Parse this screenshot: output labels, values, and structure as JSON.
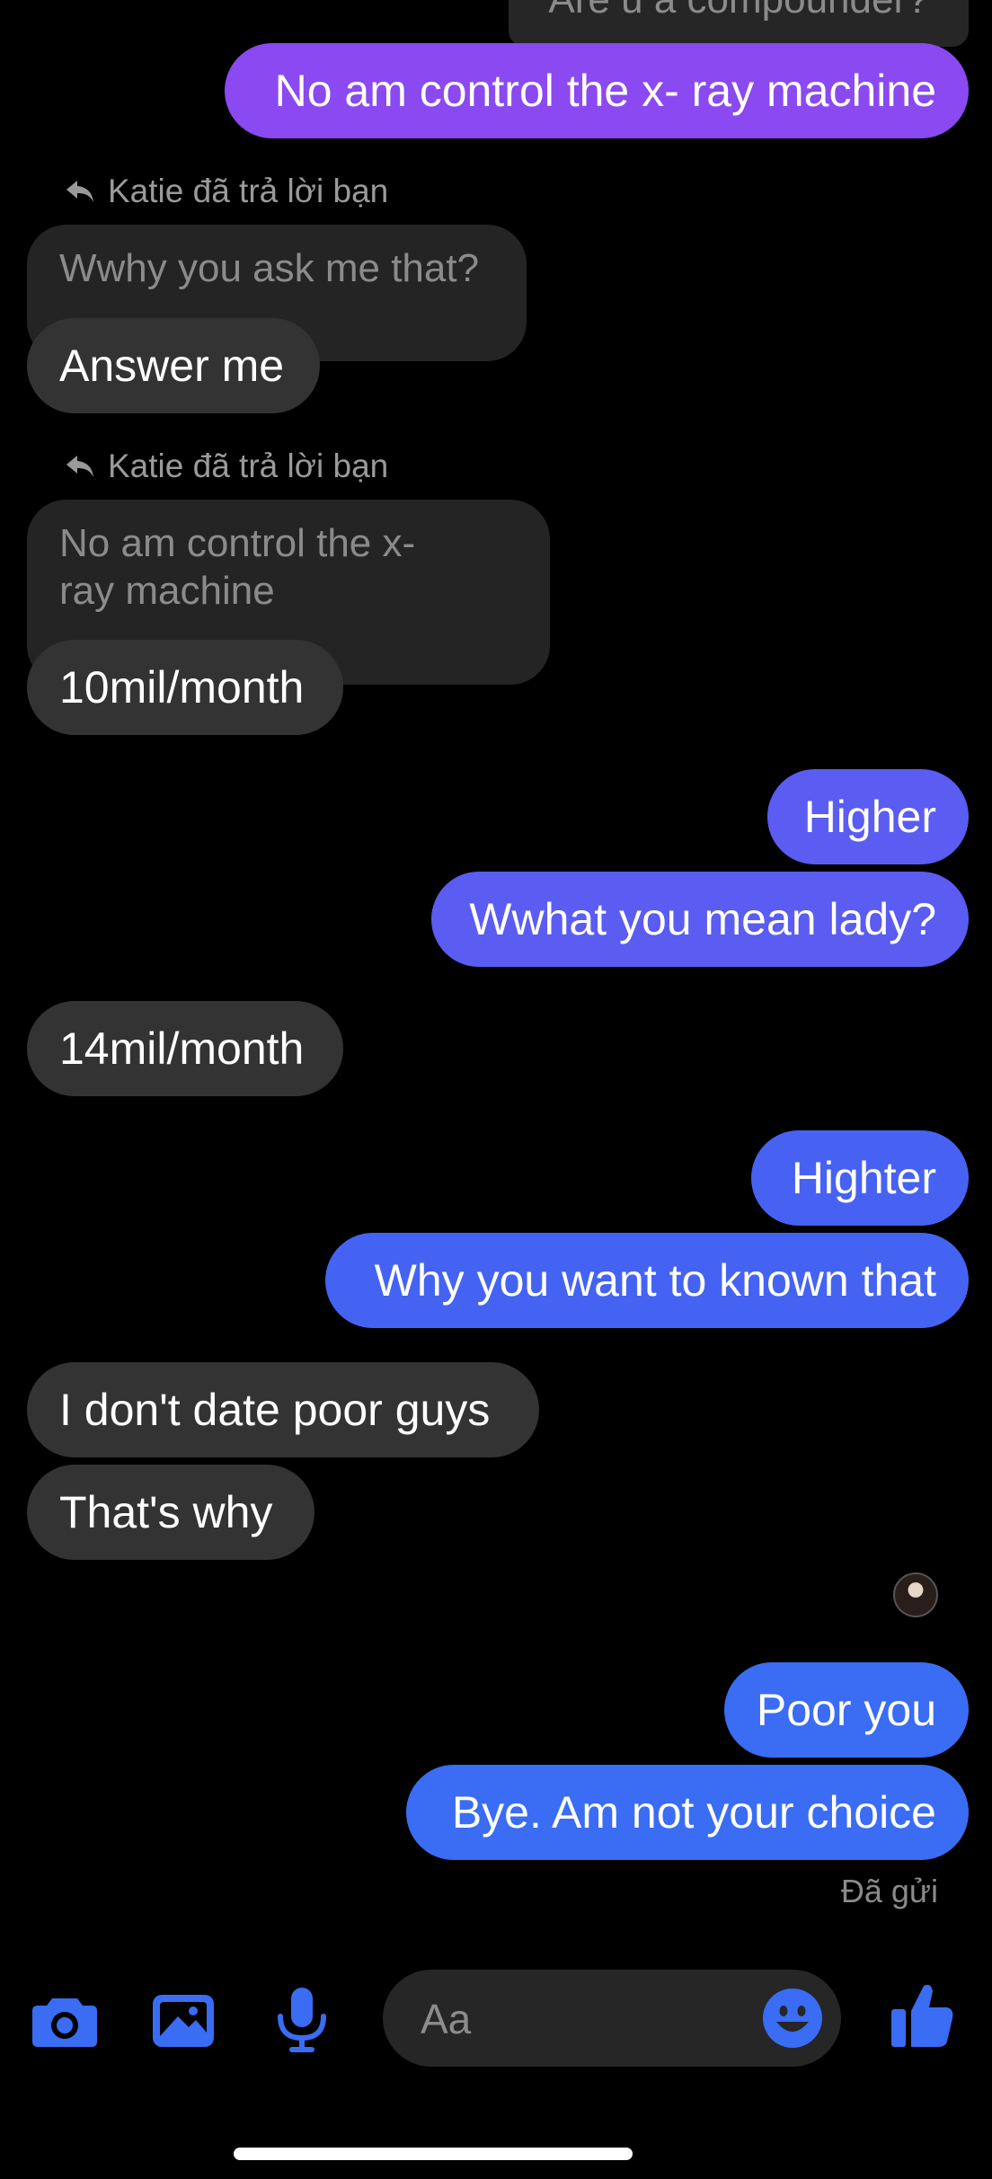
{
  "colors": {
    "background": "#000000",
    "incoming_bubble": "#333333",
    "quoted_bubble": "#242424",
    "accent_blue": "#3a6cf4",
    "outgoing_gradient_top": "#8e44f0",
    "outgoing_gradient_bottom": "#3a6cf4"
  },
  "top_partial_message": "Are u a compounder?",
  "messages": [
    {
      "dir": "out",
      "text": "No am control the x- ray machine",
      "color": "#8a49f1"
    },
    {
      "dir": "in",
      "reply_label": "Katie đã trả lời bạn",
      "quoted": "Wwhy you ask me that?",
      "text": "Answer me"
    },
    {
      "dir": "in",
      "reply_label": "Katie đã trả lời bạn",
      "quoted_lines": [
        "No am control the x-",
        "ray machine"
      ],
      "text": "10mil/month"
    },
    {
      "dir": "out",
      "text": "Higher",
      "color": "#5b5cf2"
    },
    {
      "dir": "out",
      "text": "Wwhat you mean lady?",
      "color": "#5a5cf2"
    },
    {
      "dir": "in",
      "text": "14mil/month"
    },
    {
      "dir": "out",
      "text": "Highter",
      "color": "#4762f3"
    },
    {
      "dir": "out",
      "text": "Why you want to known that",
      "color": "#4563f3"
    },
    {
      "dir": "in",
      "text": "I don't date poor guys"
    },
    {
      "dir": "in",
      "text": "That's why"
    },
    {
      "dir": "out",
      "text": "Poor you",
      "color": "#3a6cf4"
    },
    {
      "dir": "out",
      "text": "Bye. Am not your choice",
      "color": "#3a6cf4"
    }
  ],
  "seen_by": "avatar-icon",
  "status": "Đã gửi",
  "composer": {
    "placeholder": "Aa",
    "icons": [
      "camera-icon",
      "image-icon",
      "microphone-icon",
      "emoji-icon",
      "thumbs-up-icon"
    ]
  }
}
